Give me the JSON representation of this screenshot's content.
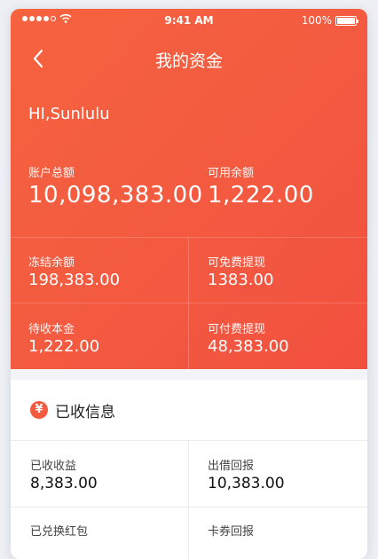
{
  "status_bar": {
    "time": "9:41 AM",
    "battery": "100%"
  },
  "nav": {
    "title": "我的资金"
  },
  "greeting": "HI,Sunlulu",
  "summary": {
    "total_label": "账户总额",
    "total_value": "10,098,383.00",
    "available_label": "可用余额",
    "available_value": "1,222.00"
  },
  "grid": [
    {
      "label": "冻结余额",
      "value": "198,383.00"
    },
    {
      "label": "可免费提现",
      "value": "1383.00"
    },
    {
      "label": "待收本金",
      "value": "1,222.00"
    },
    {
      "label": "可付费提现",
      "value": "48,383.00"
    }
  ],
  "received": {
    "icon_glyph": "¥",
    "title": "已收信息",
    "items": [
      {
        "label": "已收收益",
        "value": "8,383.00"
      },
      {
        "label": "出借回报",
        "value": "10,383.00"
      },
      {
        "label": "已兑换红包",
        "value": ""
      },
      {
        "label": "卡券回报",
        "value": ""
      }
    ]
  },
  "colors": {
    "accent": "#f35a40",
    "background": "#eef0f5"
  }
}
